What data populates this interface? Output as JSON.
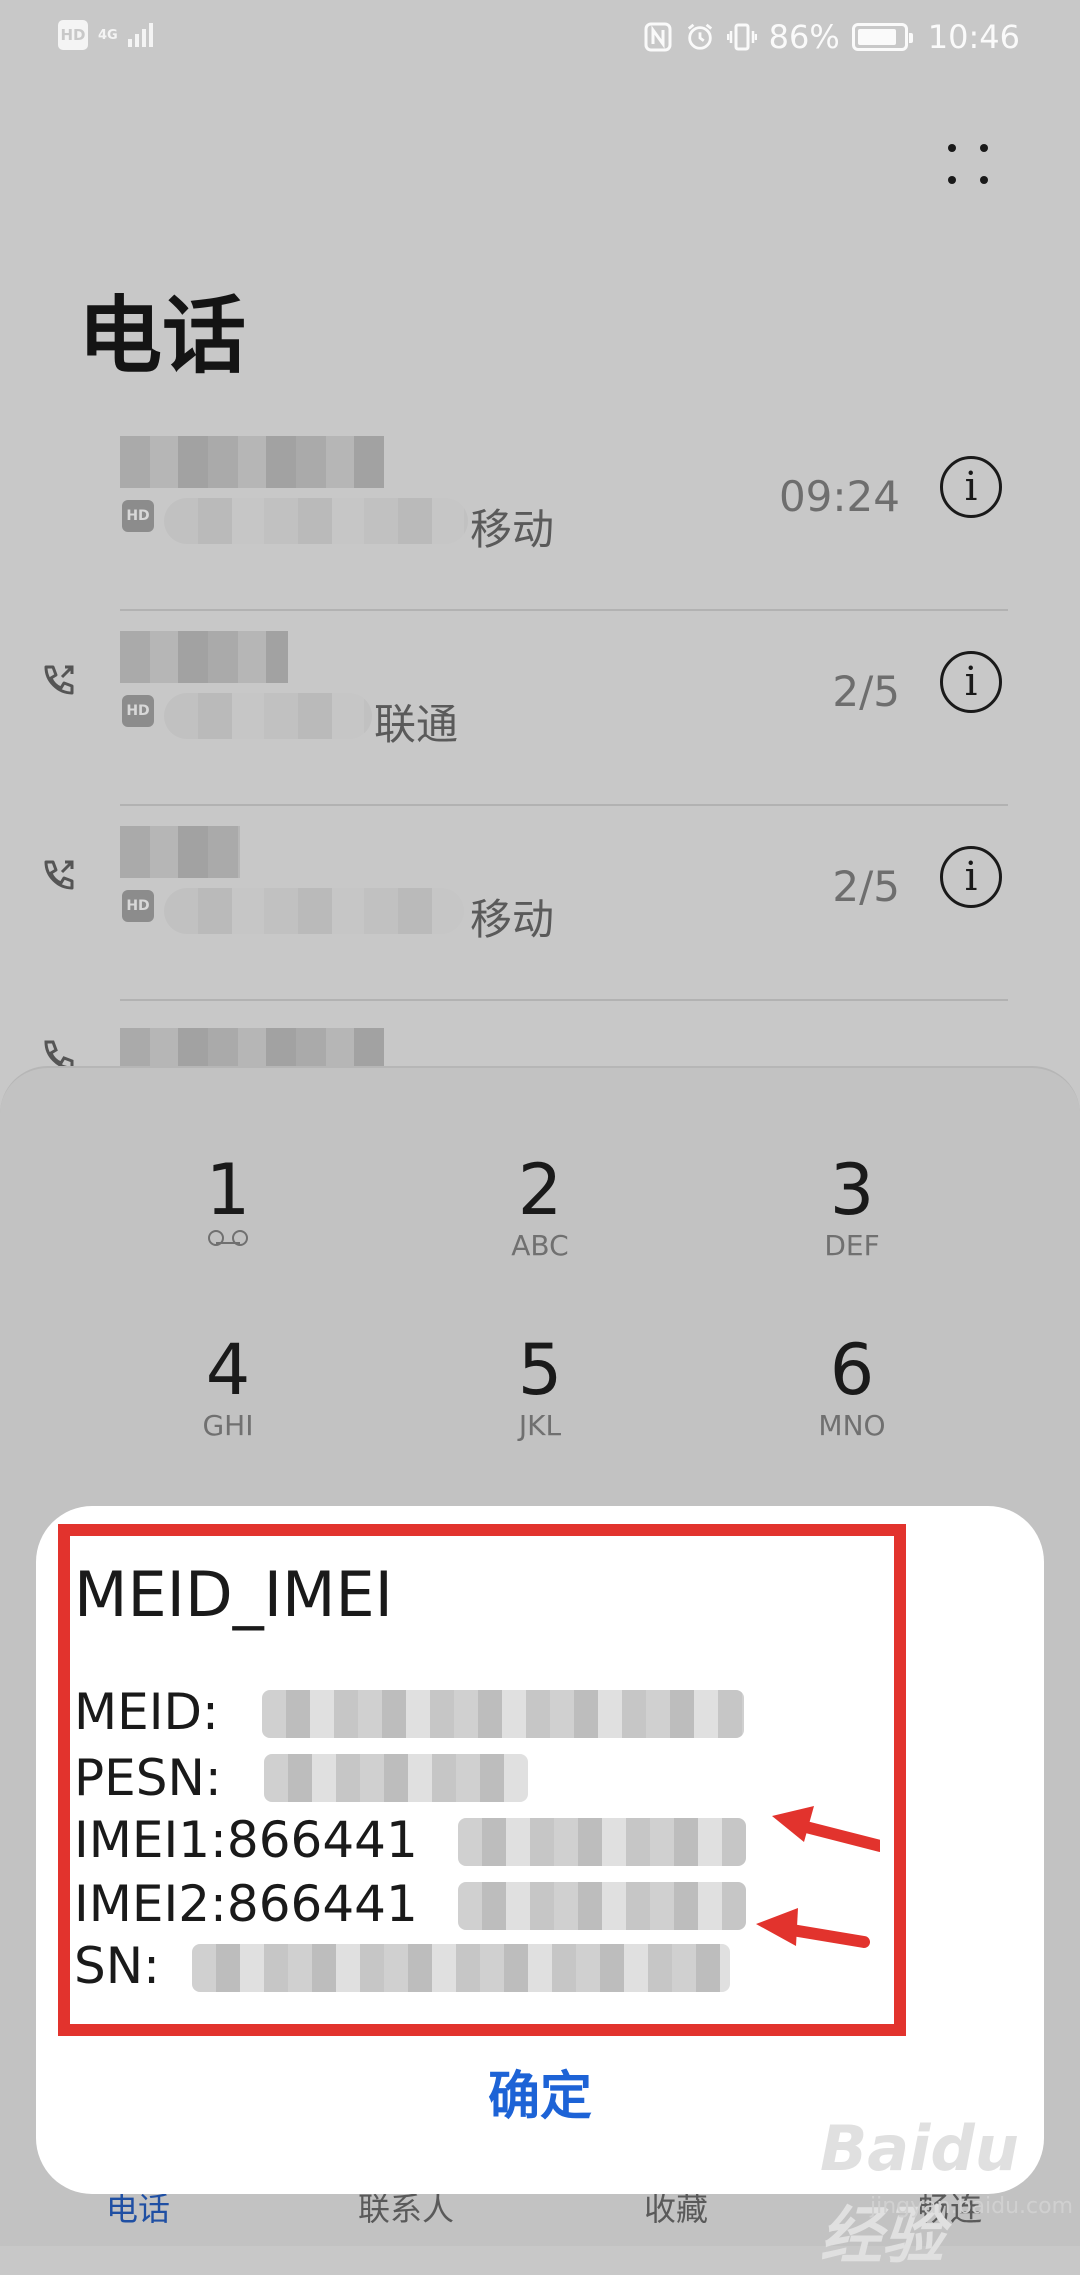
{
  "status_bar": {
    "hd": "HD",
    "network": "4G",
    "battery_level": "86%",
    "battery_fraction": 0.86,
    "time": "10:46",
    "icons": [
      "nfc-icon",
      "alarm-icon",
      "vibrate-icon"
    ]
  },
  "header": {
    "title": "电话",
    "more_icon": "more-dots-icon"
  },
  "call_log": [
    {
      "carrier": "移动",
      "time": "09:24",
      "hd": "HD",
      "type_icon": ""
    },
    {
      "carrier": "联通",
      "time": "2/5",
      "hd": "HD",
      "type_icon": "outgoing-call-icon"
    },
    {
      "carrier": "移动",
      "time": "2/5",
      "hd": "HD",
      "type_icon": "outgoing-call-icon"
    }
  ],
  "info_glyph": "i",
  "dialpad": {
    "keys": [
      {
        "digit": "1",
        "letters": ""
      },
      {
        "digit": "2",
        "letters": "ABC"
      },
      {
        "digit": "3",
        "letters": "DEF"
      },
      {
        "digit": "4",
        "letters": "GHI"
      },
      {
        "digit": "5",
        "letters": "JKL"
      },
      {
        "digit": "6",
        "letters": "MNO"
      }
    ]
  },
  "bottom_nav": [
    "电话",
    "联系人",
    "收藏",
    "畅连"
  ],
  "dialog": {
    "title": "MEID_IMEI",
    "lines": [
      {
        "label": "MEID:"
      },
      {
        "label": "PESN:"
      },
      {
        "label": "IMEI1:866441"
      },
      {
        "label": "IMEI2:866441"
      },
      {
        "label": "SN:"
      }
    ],
    "confirm": "确定"
  },
  "watermark": {
    "brand": "Baidu经验",
    "site": "jingyan.baidu.com"
  },
  "colors": {
    "annotation": "#e2332d",
    "accent": "#1d63d6"
  }
}
